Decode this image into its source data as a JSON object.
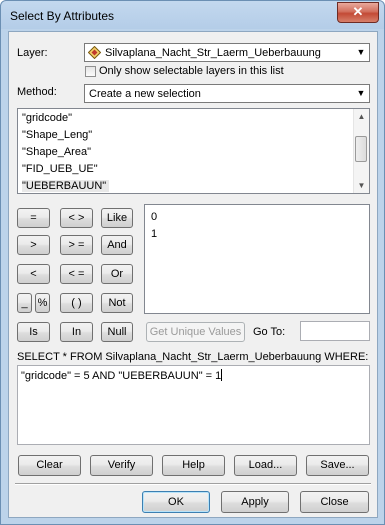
{
  "window": {
    "title": "Select By Attributes",
    "close_label": "✕"
  },
  "layer": {
    "label": "Layer:",
    "value": "Silvaplana_Nacht_Str_Laerm_Ueberbauung",
    "selectable_only_label": "Only show selectable layers in this list",
    "selectable_only_checked": false
  },
  "method": {
    "label": "Method:",
    "value": "Create a new selection"
  },
  "fields": [
    {
      "label": "\"gridcode\""
    },
    {
      "label": "\"Shape_Leng\""
    },
    {
      "label": "\"Shape_Area\""
    },
    {
      "label": "\"FID_UEB_UE\""
    },
    {
      "label": "\"UEBERBAUUN\"",
      "selected": true
    }
  ],
  "operators": {
    "eq": "=",
    "ne": "< >",
    "like": "Like",
    "gt": ">",
    "ge": "> =",
    "and": "And",
    "lt": "<",
    "le": "< =",
    "or": "Or",
    "underscore": "_",
    "percent": "%",
    "parens": "( )",
    "not": "Not",
    "is": "Is",
    "in": "In",
    "null": "Null"
  },
  "unique_values": [
    "0",
    "1"
  ],
  "get_unique_values_label": "Get Unique Values",
  "goto_label": "Go To:",
  "goto_value": "",
  "sql_prefix": "SELECT * FROM Silvaplana_Nacht_Str_Laerm_Ueberbauung WHERE:",
  "sql_expression": "\"gridcode\" = 5 AND \"UEBERBAUUN\" = 1",
  "actions": {
    "clear": "Clear",
    "verify": "Verify",
    "help": "Help",
    "load": "Load...",
    "save": "Save..."
  },
  "dialog": {
    "ok": "OK",
    "apply": "Apply",
    "close": "Close"
  }
}
